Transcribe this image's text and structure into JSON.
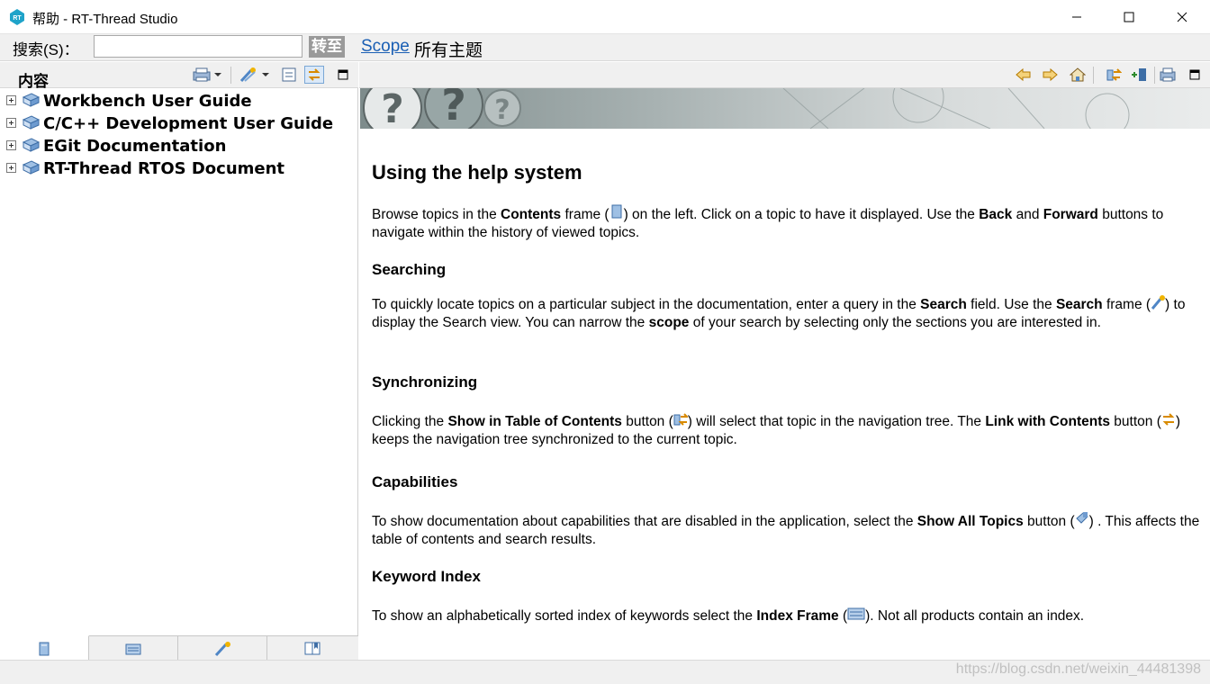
{
  "window": {
    "title": "帮助  -  RT-Thread Studio",
    "controls": [
      "minimize-icon",
      "maximize-icon",
      "close-icon"
    ]
  },
  "search": {
    "label": "搜索(S)：",
    "value": "",
    "go_label": "转至",
    "scope_link": "Scope",
    "scope_text": "所有主题"
  },
  "left": {
    "title": "内容",
    "toolbar_icons": [
      "print-icon",
      "search-results-icon",
      "collapse-all-icon",
      "link-with-contents-icon",
      "view-menu-icon"
    ],
    "tree": [
      {
        "label": "Workbench User Guide"
      },
      {
        "label": "C/C++ Development User Guide"
      },
      {
        "label": "EGit Documentation"
      },
      {
        "label": "RT-Thread RTOS Document"
      }
    ],
    "bottom_tabs": [
      "contents-tab-icon",
      "index-tab-icon",
      "search-tab-icon",
      "bookmarks-tab-icon"
    ]
  },
  "right": {
    "toolbar_icons": [
      "back-icon",
      "forward-icon",
      "home-icon",
      "show-in-toc-icon",
      "bookmark-document-icon",
      "print-page-icon",
      "view-menu-icon"
    ]
  },
  "article": {
    "title": "Using the help system",
    "intro": {
      "t1": "Browse topics in the ",
      "b1": "Contents",
      "t2": " frame (",
      "t3": ") on the left. Click on a topic to have it displayed. Use the ",
      "b2": "Back",
      "t4": " and ",
      "b3": "Forward",
      "t5": " buttons to navigate within the history of viewed topics."
    },
    "searching": {
      "heading": "Searching",
      "t1": "To quickly locate topics on a particular subject in the documentation, enter a query in the ",
      "b1": "Search",
      "t2": " field. Use the ",
      "b2": "Search",
      "t3": " frame (",
      "t4": ") to display the Search view. You can narrow the ",
      "b3": "scope",
      "t5": " of your search by selecting only the sections you are interested in."
    },
    "synchronizing": {
      "heading": "Synchronizing",
      "t1": "Clicking the ",
      "b1": "Show in Table of Contents",
      "t2": " button (",
      "t3": ") will select that topic in the navigation tree. The ",
      "b2": "Link with Contents",
      "t4": " button (",
      "t5": ") keeps the navigation tree synchronized to the current topic."
    },
    "capabilities": {
      "heading": "Capabilities",
      "t1": "To show documentation about capabilities that are disabled in the application, select the ",
      "b1": "Show All Topics",
      "t2": " button (",
      "t3": ") . This affects the table of contents and search results."
    },
    "keyword_index": {
      "heading": "Keyword Index",
      "t1": "To show an alphabetically sorted index of keywords select the ",
      "b1": "Index Frame",
      "t2": " (",
      "t3": "). Not all products contain an index."
    }
  },
  "status": {
    "watermark": "https://blog.csdn.net/weixin_44481398"
  }
}
